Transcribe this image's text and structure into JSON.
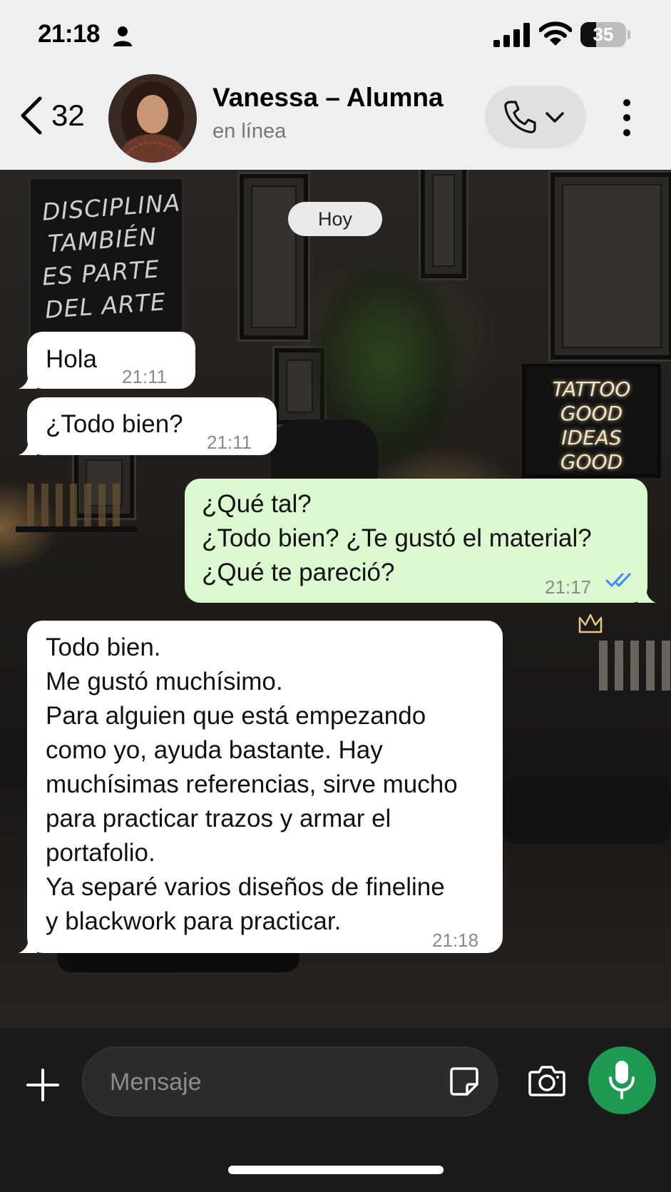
{
  "status_bar": {
    "time": "21:18",
    "battery": "35",
    "battery_level": 0.35
  },
  "header": {
    "back_count": "32",
    "contact_name": "Vanessa – Alumna",
    "contact_status": "en línea"
  },
  "background_text": {
    "chalkboard": [
      "DISCIPLINA",
      "TAMBIÉN",
      "ES PARTE",
      "DEL ARTE"
    ],
    "neon": [
      "TATTOO",
      "GOOD",
      "IDEAS",
      "GOOD"
    ]
  },
  "chat": {
    "date_label": "Hoy",
    "messages": [
      {
        "direction": "in",
        "text": "Hola",
        "time": "21:11"
      },
      {
        "direction": "in",
        "text": "¿Todo bien?",
        "time": "21:11"
      },
      {
        "direction": "out",
        "text": "¿Qué tal?\n¿Todo bien? ¿Te gustó el material?\n¿Qué te pareció?",
        "time": "21:17",
        "status": "read"
      },
      {
        "direction": "in",
        "text": "Todo bien.\nMe gustó muchísimo.\nPara alguien que está empezando\ncomo yo, ayuda bastante. Hay\nmuchísimas referencias, sirve mucho\npara practicar trazos y armar el\nportafolio.\nYa separé varios diseños de fineline\ny blackwork para practicar.",
        "time": "21:18"
      }
    ]
  },
  "input_bar": {
    "placeholder": "Mensaje"
  },
  "colors": {
    "outgoing_bubble": "#dcf8d0",
    "read_checks": "#3b8cf0",
    "mic_button": "#1f9a52"
  }
}
